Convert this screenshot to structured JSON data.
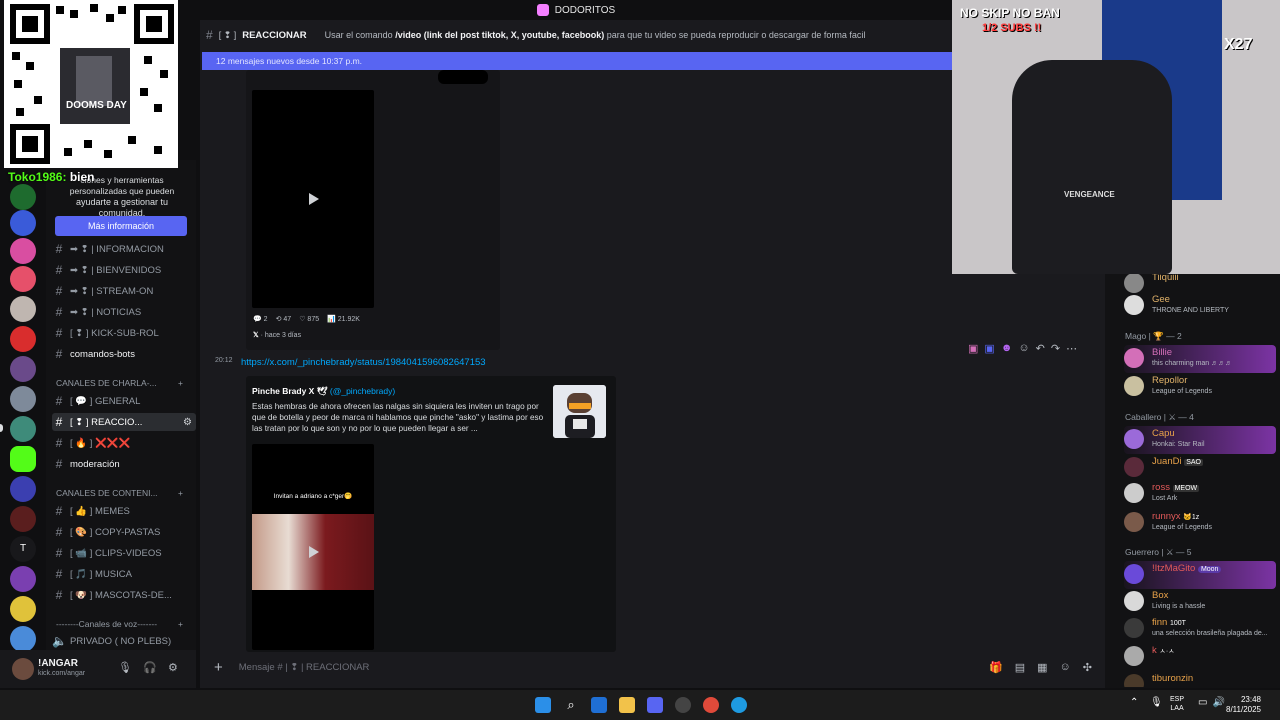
{
  "window": {
    "title": "DODORITOS"
  },
  "channel": {
    "name": "REACCIONAR",
    "topic_prefix": "Usar el comando",
    "topic_command": "/video (link del post tiktok, X, youtube, facebook)",
    "topic_suffix": "para que tu video se pueda reproducir o descargar de forma facil",
    "new_messages": "12 mensajes nuevos desde 10:37 p.m."
  },
  "promo": {
    "text_line1": "ciones y herramientas",
    "text_line2": "personalizadas que pueden",
    "text_line3": "ayudarte a gestionar tu comunidad.",
    "button": "Más información"
  },
  "sidebar": {
    "channels_top": [
      {
        "label": "➡ ❢ | INFORMACION"
      },
      {
        "label": "➡ ❢ | BIENVENIDOS"
      },
      {
        "label": "➡ ❢ | STREAM-ON"
      },
      {
        "label": "➡ ❢ | NOTICIAS"
      },
      {
        "label": "[ ❢ ] KICK-SUB-ROL"
      }
    ],
    "comandos": "comandos-bots",
    "cat_charla": "CANALES DE CHARLA-...",
    "general": "[ 💬 ] GENERAL",
    "reaccionar": "[ ❢ ] REACCIO...",
    "xxx": "[ 🔥 ] ❌❌❌",
    "moderacion": "moderación",
    "cat_contenido": "CANALES DE CONTENI...",
    "content_channels": [
      {
        "label": "[ 👍 ] MEMES"
      },
      {
        "label": "[ 🎨 ] COPY-PASTAS"
      },
      {
        "label": "[ 📹 ] CLIPS-VIDEOS"
      },
      {
        "label": "[ 🎵 ] MUSICA"
      },
      {
        "label": "[ 🐶 ] MASCOTAS-DE..."
      }
    ],
    "cat_voz": "Canales de voz",
    "voz": "PRIVADO ( NO PLEBS)"
  },
  "user": {
    "name": "!ANGAR",
    "sub": "kick.com/angar"
  },
  "messages": {
    "video_stats": {
      "replies": "2",
      "retweets": "47",
      "likes": "875",
      "views": "21.92K"
    },
    "video_time": "hace 3 días",
    "time": "20:12",
    "link": "https://x.com/_pinchebrady/status/1984041596082647153",
    "author": "Pinche Brady X 🕊",
    "author_handle": "(@_pinchebrady)",
    "embed_text": "Estas hembras de ahora ofrecen las nalgas sin siquiera les inviten un trago por que de botella y peor de marca ni hablamos que pinche \"asko\" y lastima por eso las tratan por lo que son y no por lo que pueden llegar a ser ...",
    "video_caption": "Invitan a adriano a c*ger🤭"
  },
  "input": {
    "placeholder": "Mensaje # | ❢ | REACCIONAR"
  },
  "members": {
    "top_partial": {
      "name": "Tiiquiii"
    },
    "gee": {
      "name": "Gee",
      "status": "THRONE AND LIBERTY"
    },
    "mago_header": "Mago | 🏆 — 2",
    "mago": [
      {
        "name": "Billie",
        "status": "this charming man ♬♬♬",
        "color": "#d36fb8"
      },
      {
        "name": "Repollor",
        "status": "League of Legends",
        "color": "#e2b36a"
      }
    ],
    "caballero_header": "Caballero | ⚔ — 4",
    "caballero": [
      {
        "name": "Capu",
        "status": "Honkai: Star Rail",
        "color": "#e8a24a"
      },
      {
        "name": "JuanDi",
        "status": "",
        "badge": "SAO",
        "color": "#e8a24a"
      },
      {
        "name": "ross",
        "status": "Lost Ark",
        "badge": "MEOW",
        "color": "#e8a24a"
      },
      {
        "name": "runnyx",
        "status": "League of Legends",
        "badge": "🐱1z",
        "color": "#e8a24a"
      }
    ],
    "guerrero_header": "Guerrero | ⚔ — 5",
    "guerrero": [
      {
        "name": "!ItzMaGito",
        "status": "",
        "badge": "Moon",
        "color": "#e8a24a"
      },
      {
        "name": "Box",
        "status": "Living is a hassle",
        "color": "#e8a24a"
      },
      {
        "name": "finn",
        "status": "una selección brasileña plagada de...",
        "badge": "100T",
        "color": "#e8a24a"
      },
      {
        "name": "k",
        "status": "",
        "badge": "ㅅ·ㅅ",
        "color": "#e8a24a"
      },
      {
        "name": "tiburonzin",
        "status": "",
        "color": "#e8a24a"
      }
    ]
  },
  "overlay": {
    "chat_user": "Toko1986:",
    "chat_msg": "bien",
    "qr_label": "DOOMS DAY",
    "banner1": "NO SKIP NO BAN",
    "banner2": "1/2 SUBS !!",
    "banner3": "X27",
    "chair_logo": "VENGEANCE"
  },
  "taskbar": {
    "lang1": "ESP",
    "lang2": "LAA",
    "time": "23:48",
    "date": "8/11/2025"
  }
}
